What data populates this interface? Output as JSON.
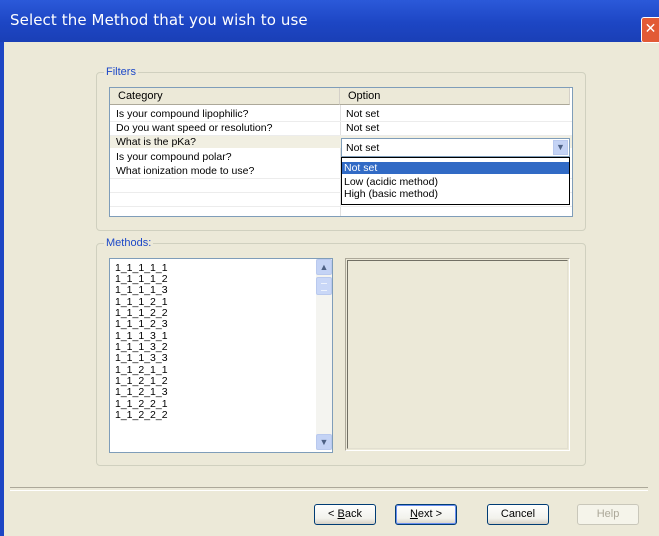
{
  "window": {
    "title": "Select the Method that you wish to use"
  },
  "filters": {
    "label": "Filters",
    "columns": [
      "Category",
      "Option"
    ],
    "rows": [
      {
        "category": "Is your compound lipophilic?",
        "option": "Not set"
      },
      {
        "category": "Do you want speed or resolution?",
        "option": "Not set"
      },
      {
        "category": "What is the pKa?",
        "option": "Not set"
      },
      {
        "category": "Is your compound polar?",
        "option": ""
      },
      {
        "category": "What ionization mode to use?",
        "option": ""
      }
    ],
    "combo": {
      "value": "Not set",
      "options": [
        "Not set",
        "Low (acidic method)",
        "High (basic method)"
      ],
      "selected": "Not set"
    }
  },
  "methods": {
    "label": "Methods:",
    "items": [
      "1_1_1_1_1",
      "1_1_1_1_2",
      "1_1_1_1_3",
      "1_1_1_2_1",
      "1_1_1_2_2",
      "1_1_1_2_3",
      "1_1_1_3_1",
      "1_1_1_3_2",
      "1_1_1_3_3",
      "1_1_2_1_1",
      "1_1_2_1_2",
      "1_1_2_1_3",
      "1_1_2_2_1",
      "1_1_2_2_2"
    ]
  },
  "buttons": {
    "back": {
      "pre": "< ",
      "accel": "B",
      "post": "ack"
    },
    "next": {
      "accel": "N",
      "post": "ext >"
    },
    "cancel": "Cancel",
    "help": "Help"
  },
  "icons": {
    "close": "close-icon",
    "scroll_up": "arrow-up-icon",
    "scroll_down": "arrow-down-icon",
    "combo": "chevron-down-icon"
  },
  "colors": {
    "titlebar": "#1d46c4",
    "group_label": "#1c48c8",
    "selection": "#316ac5",
    "close": "#e25a36"
  }
}
